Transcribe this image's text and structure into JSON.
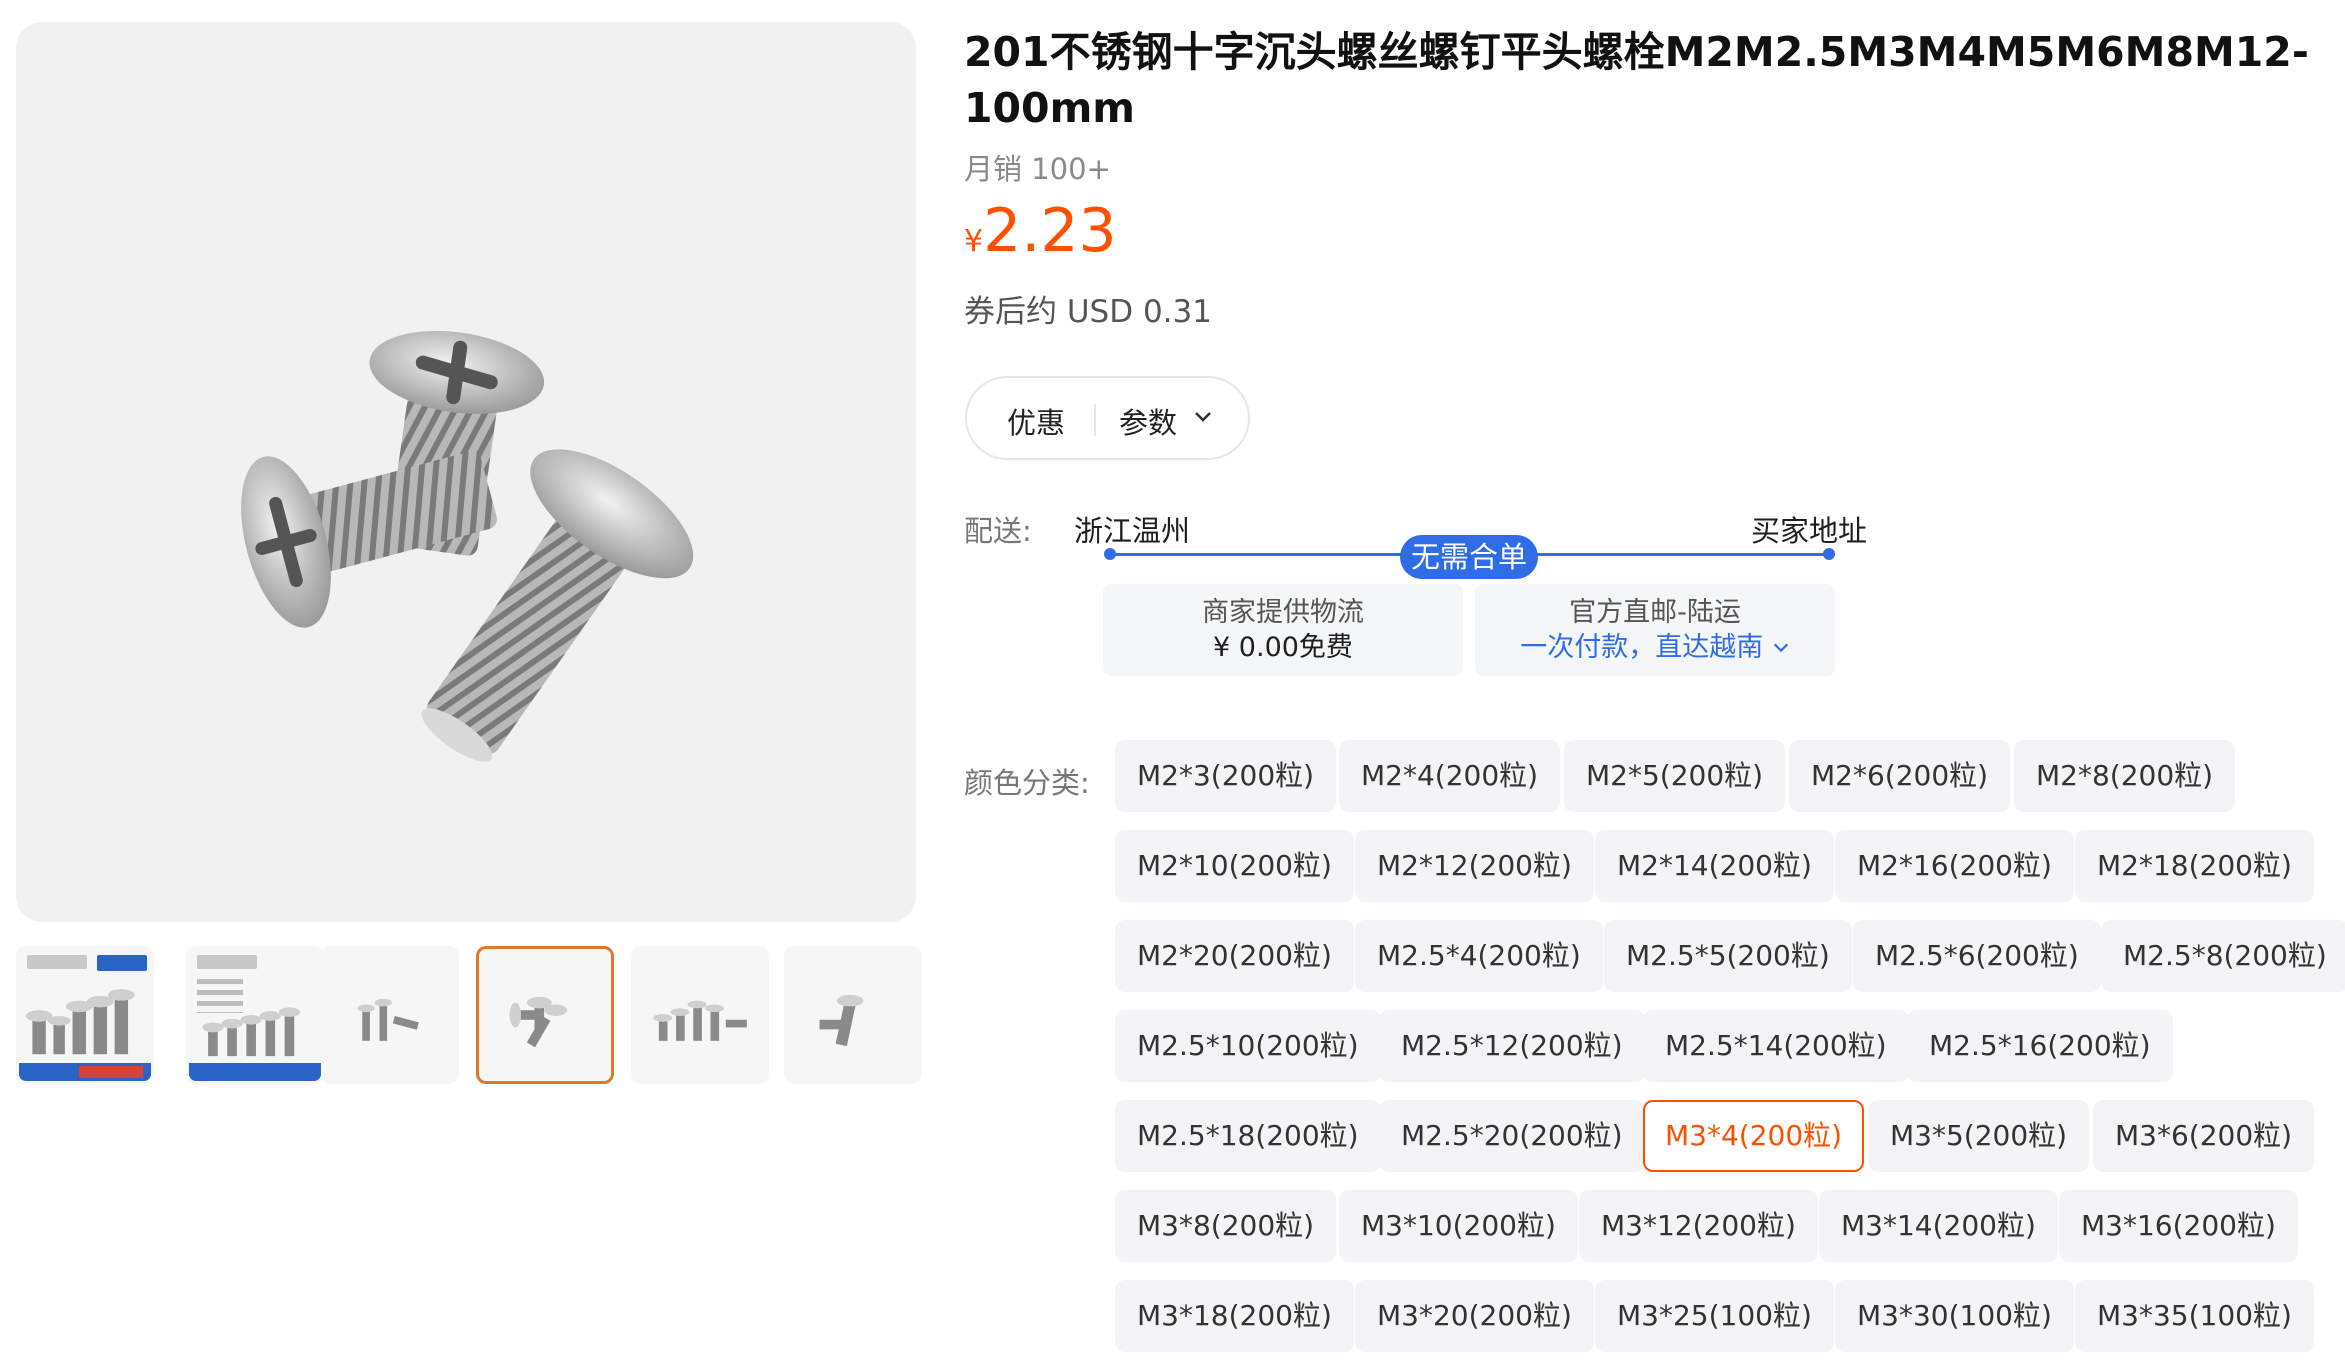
{
  "product": {
    "title": "201不锈钢十字沉头螺丝螺钉平头螺栓M2M2.5M3M4M5M6M8M12-100mm",
    "sales": "月销 100+",
    "price_currency": "¥",
    "price_value": "2.23",
    "coupon_price": "券后约 USD 0.31"
  },
  "tabs": {
    "discount": "优惠",
    "params": "参数"
  },
  "shipping": {
    "label": "配送:",
    "origin": "浙江温州",
    "destination": "买家地址",
    "badge": "无需合单",
    "box1_line1": "商家提供物流",
    "box1_line2": "¥ 0.00免费",
    "box2_line1": "官方直邮-陆运",
    "box2_line2": "一次付款，直达越南"
  },
  "options": {
    "label": "颜色分类:",
    "selected": "M3*4(200粒)",
    "items": [
      "M2*3(200粒)",
      "M2*4(200粒)",
      "M2*5(200粒)",
      "M2*6(200粒)",
      "M2*8(200粒)",
      "M2*10(200粒)",
      "M2*12(200粒)",
      "M2*14(200粒)",
      "M2*16(200粒)",
      "M2*18(200粒)",
      "M2*20(200粒)",
      "M2.5*4(200粒)",
      "M2.5*5(200粒)",
      "M2.5*6(200粒)",
      "M2.5*8(200粒)",
      "M2.5*10(200粒)",
      "M2.5*12(200粒)",
      "M2.5*14(200粒)",
      "M2.5*16(200粒)",
      "M2.5*18(200粒)",
      "M2.5*20(200粒)",
      "M3*4(200粒)",
      "M3*5(200粒)",
      "M3*6(200粒)",
      "M3*8(200粒)",
      "M3*10(200粒)",
      "M3*12(200粒)",
      "M3*14(200粒)",
      "M3*16(200粒)",
      "M3*18(200粒)",
      "M3*20(200粒)",
      "M3*25(100粒)",
      "M3*30(100粒)",
      "M3*35(100粒)"
    ]
  },
  "gallery": {
    "thumb_count": 6,
    "active_thumb_index": 3
  },
  "colors": {
    "accent": "#ff5000",
    "link": "#2f6de8",
    "thumb_active_border": "#e0782b"
  }
}
